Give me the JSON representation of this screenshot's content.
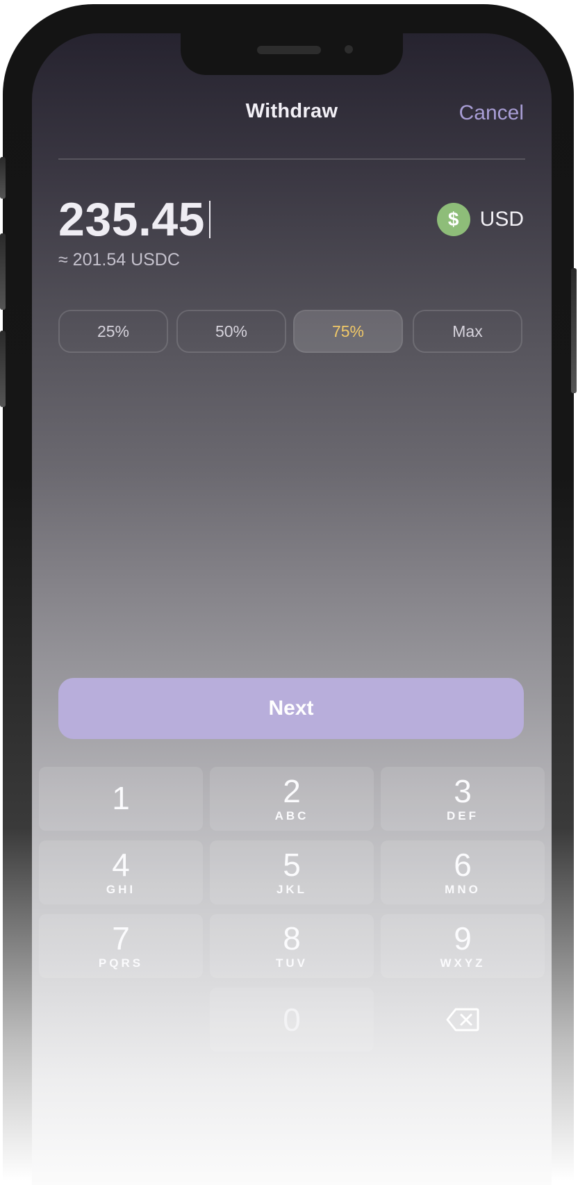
{
  "header": {
    "title": "Withdraw",
    "cancel_label": "Cancel"
  },
  "amount": {
    "value": "235.45",
    "converted": "≈ 201.54 USDC"
  },
  "currency": {
    "symbol": "$",
    "label": "USD",
    "color": "#8ebd79"
  },
  "presets": [
    {
      "label": "25%",
      "active": false
    },
    {
      "label": "50%",
      "active": false
    },
    {
      "label": "75%",
      "active": true
    },
    {
      "label": "Max",
      "active": false
    }
  ],
  "next_label": "Next",
  "keypad": [
    {
      "num": "1",
      "letters": ""
    },
    {
      "num": "2",
      "letters": "ABC"
    },
    {
      "num": "3",
      "letters": "DEF"
    },
    {
      "num": "4",
      "letters": "GHI"
    },
    {
      "num": "5",
      "letters": "JKL"
    },
    {
      "num": "6",
      "letters": "MNO"
    },
    {
      "num": "7",
      "letters": "PQRS"
    },
    {
      "num": "8",
      "letters": "TUV"
    },
    {
      "num": "9",
      "letters": "WXYZ"
    },
    {
      "num": "0",
      "letters": ""
    }
  ],
  "colors": {
    "accent": "#b8aedb",
    "cancel": "#a99ed6",
    "active_preset_text": "#f1c968"
  }
}
